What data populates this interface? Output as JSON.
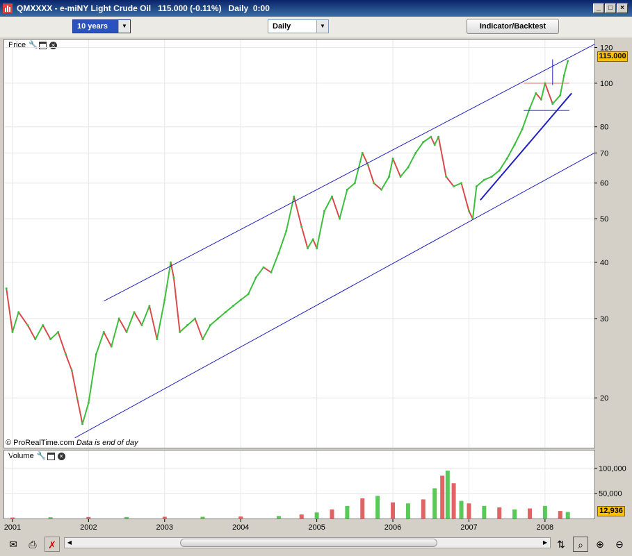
{
  "window": {
    "title": "QMXXXX - e-miNY Light Crude Oil   115.000 (-0.11%)   Daily  0:00",
    "controls": [
      "_",
      "□",
      "×"
    ]
  },
  "toolbar": {
    "period": "10 years",
    "interval": "Daily",
    "indicator_button": "Indicator/Backtest"
  },
  "price_panel": {
    "title": "Price",
    "last_value": "115.000",
    "credit": "© ProRealTime.com",
    "note": "Data is end of day"
  },
  "volume_panel": {
    "title": "Volume",
    "last_value": "12,936"
  },
  "icons": [
    "wrench-icon",
    "window-icon",
    "close-icon",
    "mail-icon",
    "print-icon",
    "no-cursor-icon",
    "zoom-select-icon",
    "zoom-in-icon",
    "zoom-out-icon",
    "scroll-arrows-icon"
  ],
  "colors": {
    "up": "#3cbf3c",
    "down": "#d94a4a",
    "trendline": "#2020c0",
    "last_value_bg": "#ffc000"
  },
  "chart_data": [
    {
      "type": "line",
      "yscale": "log",
      "ylim": [
        15.5,
        125
      ],
      "xlim": [
        2000.9,
        2008.65
      ],
      "x_ticks": [
        "2001",
        "2002",
        "2003",
        "2004",
        "2005",
        "2006",
        "2007",
        "2008"
      ],
      "x_tick_values": [
        2001,
        2002,
        2003,
        2004,
        2005,
        2006,
        2007,
        2008
      ],
      "y_ticks": [
        "20",
        "30",
        "40",
        "50",
        "60",
        "70",
        "80",
        "100",
        "120"
      ],
      "y_tick_values": [
        20,
        30,
        40,
        50,
        60,
        70,
        80,
        100,
        120
      ],
      "grid": true,
      "series": [
        {
          "x": [
            2000.92,
            2001.0,
            2001.08,
            2001.2,
            2001.3,
            2001.4,
            2001.5,
            2001.6,
            2001.7,
            2001.78,
            2001.85,
            2001.92,
            2002.0,
            2002.1,
            2002.2,
            2002.3,
            2002.4,
            2002.5,
            2002.6,
            2002.7,
            2002.8,
            2002.9,
            2003.0,
            2003.08,
            2003.12,
            2003.2,
            2003.3,
            2003.4,
            2003.5,
            2003.6,
            2003.7,
            2003.8,
            2003.9,
            2004.0,
            2004.1,
            2004.2,
            2004.3,
            2004.4,
            2004.5,
            2004.6,
            2004.7,
            2004.8,
            2004.88,
            2004.95,
            2005.0,
            2005.1,
            2005.2,
            2005.3,
            2005.4,
            2005.5,
            2005.6,
            2005.67,
            2005.75,
            2005.85,
            2005.95,
            2006.0,
            2006.1,
            2006.2,
            2006.3,
            2006.4,
            2006.5,
            2006.55,
            2006.6,
            2006.7,
            2006.8,
            2006.9,
            2007.0,
            2007.05,
            2007.1,
            2007.2,
            2007.3,
            2007.4,
            2007.5,
            2007.6,
            2007.7,
            2007.8,
            2007.88,
            2007.95,
            2008.0,
            2008.1,
            2008.2,
            2008.25,
            2008.3
          ],
          "values": [
            35,
            28,
            31,
            29,
            27,
            29,
            27,
            28,
            25,
            23,
            20,
            17.5,
            19.5,
            25,
            28,
            26,
            30,
            28,
            31,
            29,
            32,
            27,
            33,
            40,
            37,
            28,
            29,
            30,
            27,
            29,
            30,
            31,
            32,
            33,
            34,
            37,
            39,
            38,
            42,
            47,
            56,
            48,
            43,
            45,
            43,
            52,
            56,
            50,
            58,
            60,
            70,
            66,
            60,
            58,
            62,
            68,
            62,
            65,
            70,
            74,
            76,
            73,
            76,
            62,
            59,
            60,
            52,
            50,
            59,
            61,
            62,
            64,
            68,
            73,
            79,
            88,
            95,
            92,
            100,
            90,
            94,
            104,
            112
          ]
        }
      ],
      "annotations": [
        {
          "type": "line",
          "x": [
            2002.2,
            2008.65
          ],
          "values": [
            32.8,
            122
          ]
        },
        {
          "type": "line",
          "x": [
            2001.82,
            2008.65
          ],
          "values": [
            16.3,
            70
          ]
        },
        {
          "type": "line",
          "x": [
            2007.15,
            2008.35
          ],
          "values": [
            55,
            95
          ]
        },
        {
          "type": "line",
          "x": [
            2007.72,
            2008.32
          ],
          "values": [
            100,
            100
          ]
        },
        {
          "type": "line",
          "x": [
            2007.72,
            2008.32
          ],
          "values": [
            87,
            87
          ]
        },
        {
          "type": "line",
          "x": [
            2008.1,
            2008.1
          ],
          "values": [
            99,
            113
          ]
        }
      ]
    },
    {
      "type": "bar",
      "ylim": [
        0,
        135000
      ],
      "y_ticks": [
        "50,000",
        "100,000"
      ],
      "y_tick_values": [
        50000,
        100000
      ],
      "x": [
        2001.0,
        2001.5,
        2002.0,
        2002.5,
        2003.0,
        2003.5,
        2004.0,
        2004.5,
        2004.8,
        2005.0,
        2005.2,
        2005.4,
        2005.6,
        2005.8,
        2006.0,
        2006.2,
        2006.4,
        2006.55,
        2006.65,
        2006.72,
        2006.8,
        2006.9,
        2007.0,
        2007.2,
        2007.4,
        2007.6,
        2007.8,
        2008.0,
        2008.2,
        2008.3
      ],
      "values": [
        2000,
        2500,
        3000,
        3000,
        3500,
        3500,
        4000,
        5000,
        8000,
        12000,
        18000,
        25000,
        40000,
        45000,
        32000,
        30000,
        38000,
        60000,
        85000,
        95000,
        70000,
        35000,
        30000,
        25000,
        22000,
        18000,
        20000,
        25000,
        15000,
        12936
      ]
    }
  ]
}
